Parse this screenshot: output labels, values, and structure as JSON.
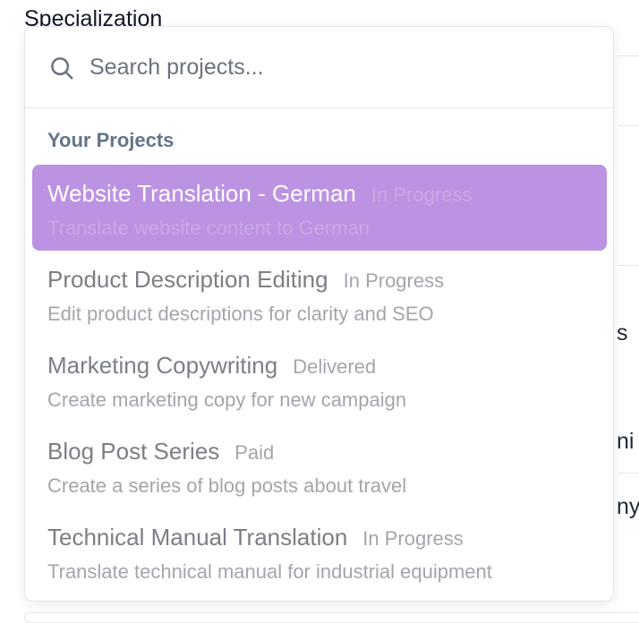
{
  "background": {
    "label": "Specialization",
    "fragments": [
      "s",
      "ni",
      "ny"
    ]
  },
  "search": {
    "placeholder": "Search projects...",
    "value": ""
  },
  "group": {
    "heading": "Your Projects"
  },
  "projects": [
    {
      "title": "Website Translation - German",
      "status": "In Progress",
      "description": "Translate website content to German",
      "selected": true
    },
    {
      "title": "Product Description Editing",
      "status": "In Progress",
      "description": "Edit product descriptions for clarity and SEO",
      "selected": false
    },
    {
      "title": "Marketing Copywriting",
      "status": "Delivered",
      "description": "Create marketing copy for new campaign",
      "selected": false
    },
    {
      "title": "Blog Post Series",
      "status": "Paid",
      "description": "Create a series of blog posts about travel",
      "selected": false
    },
    {
      "title": "Technical Manual Translation",
      "status": "In Progress",
      "description": "Translate technical manual for industrial equipment",
      "selected": false
    }
  ],
  "colors": {
    "selected_bg": "#bc92e2",
    "border": "#e3e6ea",
    "muted_text": "#a2a6ac"
  }
}
